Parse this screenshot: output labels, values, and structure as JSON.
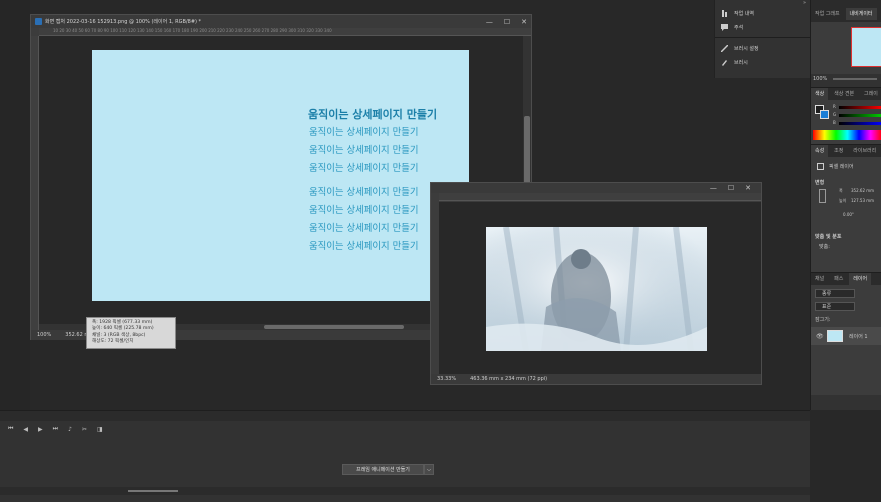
{
  "main_window": {
    "title": "화면 캡처 2022-03-16 152913.png @ 100% (레이어 1, RGB/8#) *",
    "minimize": "—",
    "restore": "☐",
    "close": "✕",
    "ruler": "10   20   30   40   50   60   70   80   90   100   110   120   130   140   150   160   170   180   190   200   210   220   230   240   250   260   270   280   290   300   310   320   330   340",
    "status_zoom": "100%",
    "status_size": "352.62 mm",
    "lines": [
      "움직이는 상세페이지 만들기",
      "움직이는 상세페이지 만들기",
      "움직이는 상세페이지 만들기",
      "움직이는 상세페이지 만들기",
      "움직이는 상세페이지 만들기",
      "움직이는 상세페이지 만들기",
      "움직이는 상세페이지 만들기",
      "움직이는 상세페이지 만들기"
    ]
  },
  "tooltip": {
    "line1": "폭: 1928 픽셀 (677.33 mm)",
    "line2": "높이: 640 픽셀 (225.78 mm)",
    "line3": "채널: 3 (RGB 색상, 8bpc)",
    "line4": "해상도: 72 픽셀/인치"
  },
  "second_window": {
    "status_zoom": "33.33%",
    "status_size": "463.36 mm x 234 mm (72 ppi)",
    "minimize": "—",
    "restore": "☐",
    "close": "✕"
  },
  "history_panel": {
    "collapse": "»",
    "items": [
      "작업 내역",
      "주석",
      "브러시 설정",
      "브러시"
    ]
  },
  "navigator": {
    "tabs": [
      "작업 그래프",
      "내비게이터"
    ],
    "zoom": "100%"
  },
  "color_panel": {
    "tabs": [
      "색상",
      "색상 견본",
      "그레이"
    ],
    "labels": [
      "R",
      "G",
      "B"
    ]
  },
  "properties": {
    "tabs": [
      "속성",
      "조정",
      "라이브러리"
    ],
    "layer_type": "픽셀 레이어",
    "transform_heading": "변형",
    "w_label": "폭",
    "w_value": "352.62 mm",
    "h_label": "높이",
    "h_value": "127.53 mm",
    "angle": "0.00°",
    "align_heading": "맞춤 및 분포",
    "align_label": "맞춤:"
  },
  "layers": {
    "tabs": [
      "채널",
      "패스",
      "레이어"
    ],
    "filter": "종류",
    "blend": "표준",
    "lock_label": "잠그기:",
    "layer_name": "레이어 1"
  },
  "timeline": {
    "create_button": "프레임 애니메이션 만들기",
    "dropdown_icon": "⌵"
  }
}
